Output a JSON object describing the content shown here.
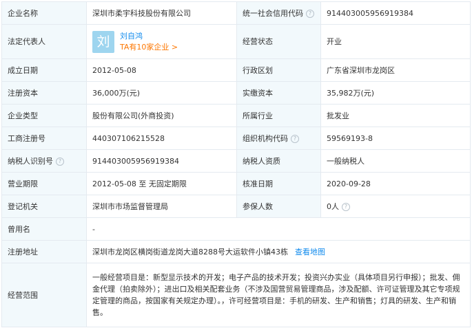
{
  "rows": {
    "company_name": {
      "label": "企业名称",
      "value": "深圳市柔宇科技股份有限公司"
    },
    "credit_code": {
      "label": "统一社会信用代码",
      "value": "914403005956919384"
    },
    "legal_rep": {
      "label": "法定代表人",
      "avatar_char": "刘",
      "name": "刘自鸿",
      "enterprises": "TA有10家企业 >"
    },
    "status": {
      "label": "经营状态",
      "value": "开业"
    },
    "founded": {
      "label": "成立日期",
      "value": "2012-05-08"
    },
    "region": {
      "label": "行政区划",
      "value": "广东省深圳市龙岗区"
    },
    "reg_capital": {
      "label": "注册资本",
      "value": "36,000万(元)"
    },
    "paid_capital": {
      "label": "实缴资本",
      "value": "35,982万(元)"
    },
    "company_type": {
      "label": "企业类型",
      "value": "股份有限公司(外商投资)"
    },
    "industry": {
      "label": "所属行业",
      "value": "批发业"
    },
    "reg_number": {
      "label": "工商注册号",
      "value": "440307106215528"
    },
    "org_code": {
      "label": "组织机构代码",
      "value": "59569193-8"
    },
    "taxpayer_id": {
      "label": "纳税人识别号",
      "value": "914403005956919384"
    },
    "taxpayer_qual": {
      "label": "纳税人资质",
      "value": "一般纳税人"
    },
    "term": {
      "label": "营业期限",
      "value": "2012-05-08 至 无固定期限"
    },
    "approval_date": {
      "label": "核准日期",
      "value": "2020-09-28"
    },
    "authority": {
      "label": "登记机关",
      "value": "深圳市市场监督管理局"
    },
    "insured": {
      "label": "参保人数",
      "value": "0人"
    },
    "former_name": {
      "label": "曾用名",
      "value": "-"
    },
    "address": {
      "label": "注册地址",
      "value": "深圳市龙岗区横岗街道龙岗大道8288号大运软件小镇43栋",
      "map_link": "查看地图"
    },
    "scope": {
      "label": "经营范围",
      "value": "一般经营项目是：新型显示技术的开发；电子产品的技术开发；投资兴办实业（具体项目另行申报）；批发、佣金代理（拍卖除外）；进出口及相关配套业务（不涉及国营贸易管理商品，涉及配额、许可证管理及其它专项规定管理的商品，按国家有关规定办理）。，许可经营项目是：手机的研发、生产和销售；灯具的研发、生产和销售。"
    }
  },
  "help_glyph": "?",
  "colors": {
    "label_bg": "#f2f9fc",
    "border": "#e4eaf0",
    "link": "#128bed",
    "accent_orange": "#fd7600",
    "avatar_bg": "#9ed5ef"
  }
}
